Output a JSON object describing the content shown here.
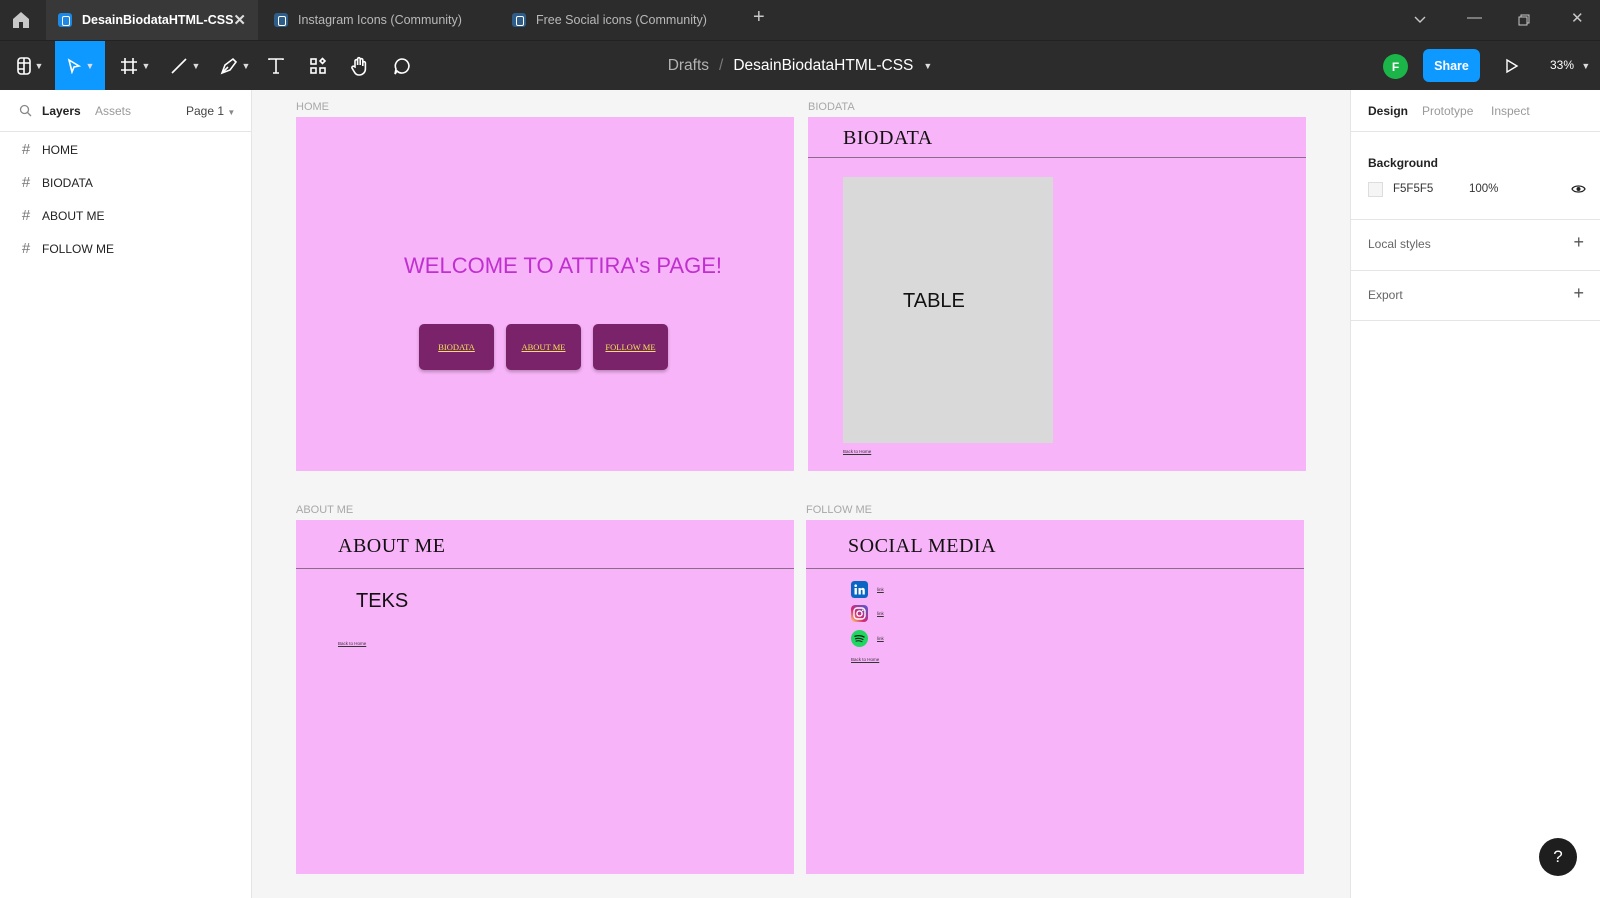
{
  "tabs": [
    {
      "label": "DesainBiodataHTML-CSS",
      "active": true
    },
    {
      "label": "Instagram Icons (Community)",
      "active": false
    },
    {
      "label": "Free Social icons (Community)",
      "active": false
    }
  ],
  "toolbar": {
    "breadcrumb_parent": "Drafts",
    "breadcrumb_sep": "/",
    "file_name": "DesainBiodataHTML-CSS",
    "avatar_initial": "F",
    "share_label": "Share",
    "zoom": "33%"
  },
  "left_panel": {
    "tab_layers": "Layers",
    "tab_assets": "Assets",
    "page_selector": "Page 1",
    "layers": [
      "HOME",
      "BIODATA",
      "ABOUT ME",
      "FOLLOW ME"
    ]
  },
  "right_panel": {
    "tabs": [
      "Design",
      "Prototype",
      "Inspect"
    ],
    "background_title": "Background",
    "background_hex": "F5F5F5",
    "background_opacity": "100%",
    "local_styles": "Local styles",
    "export": "Export"
  },
  "canvas": {
    "home": {
      "label": "HOME",
      "welcome": "WELCOME TO ATTIRA's PAGE!",
      "buttons": [
        "BIODATA",
        "ABOUT ME",
        "FOLLOW ME"
      ]
    },
    "biodata": {
      "label": "BIODATA",
      "header": "BIODATA",
      "table_text": "TABLE",
      "back_link": "Back to Home"
    },
    "about": {
      "label": "ABOUT ME",
      "header": "ABOUT ME",
      "body": "TEKS",
      "back_link": "Back to Home"
    },
    "follow": {
      "label": "FOLLOW ME",
      "header": "SOCIAL MEDIA",
      "items": [
        {
          "icon": "linkedin-icon",
          "label": "link"
        },
        {
          "icon": "instagram-icon",
          "label": "link"
        },
        {
          "icon": "spotify-icon",
          "label": "link"
        }
      ],
      "back_link": "Back to Home"
    },
    "frame_color": "#f8b4f9"
  },
  "help_label": "?"
}
